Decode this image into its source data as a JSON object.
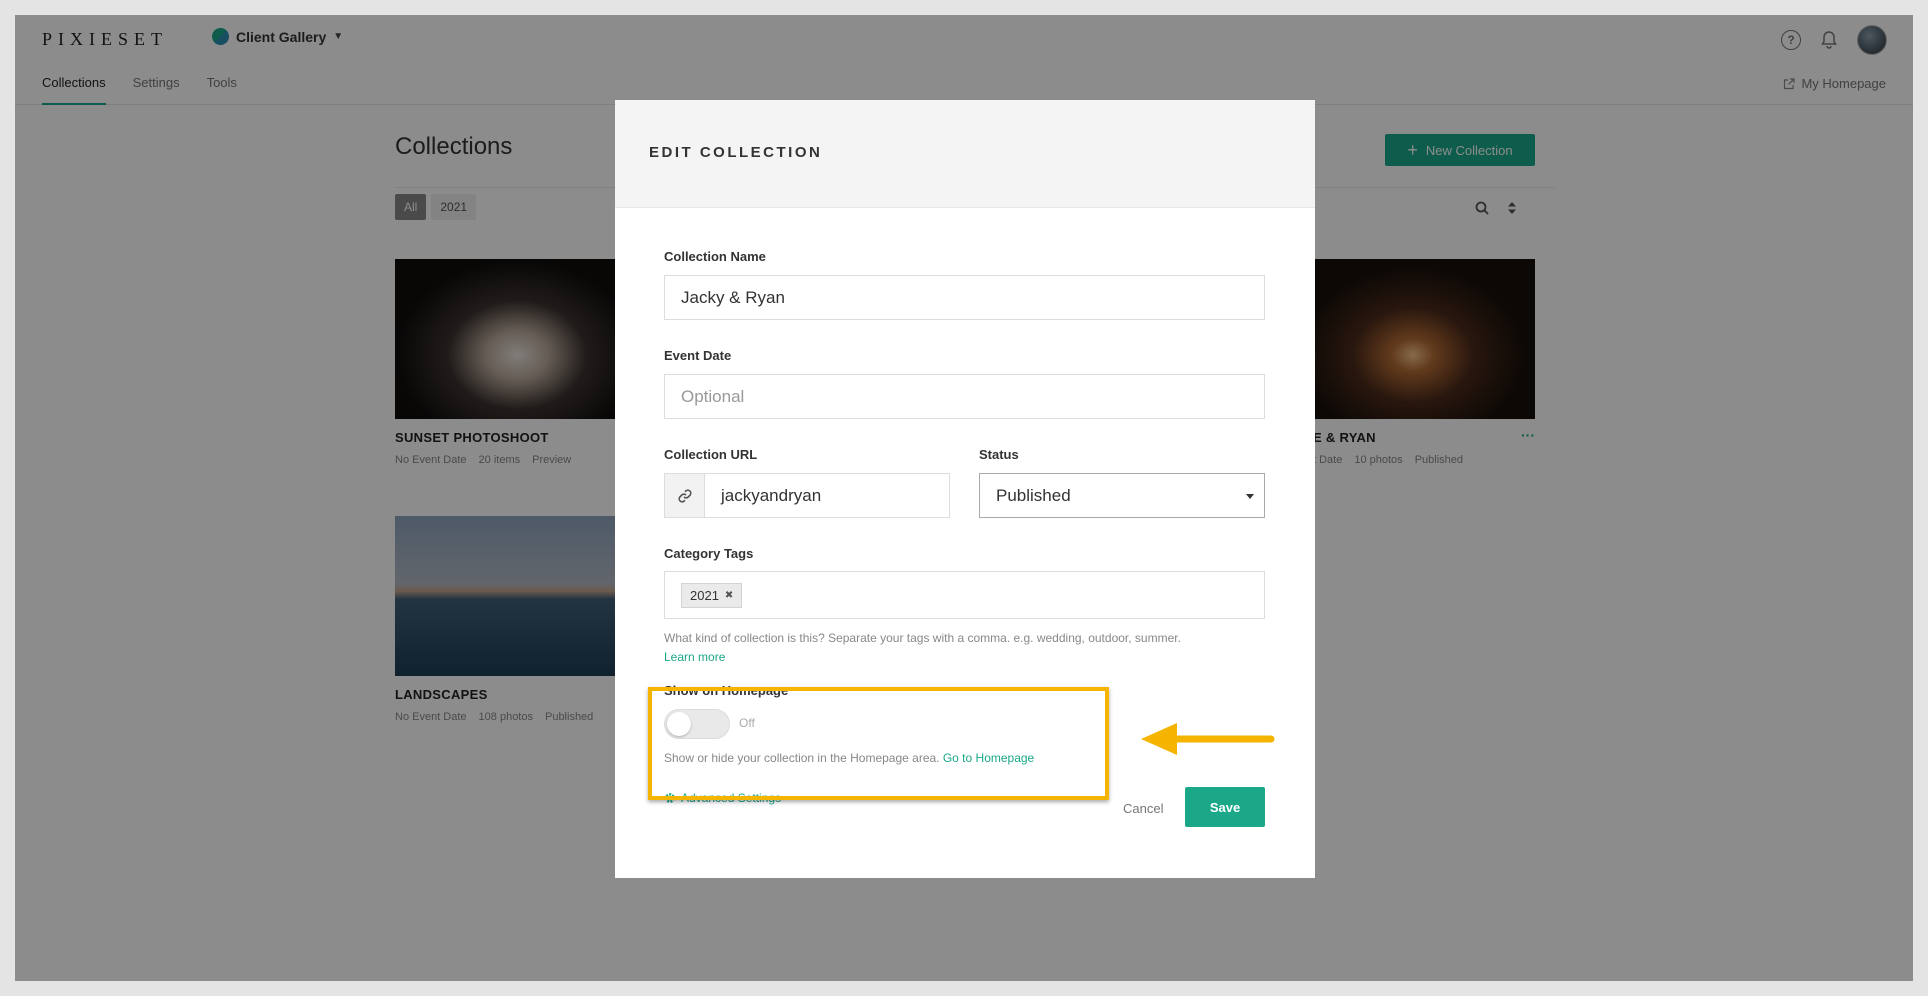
{
  "topbar": {
    "logo": "PIXIESET",
    "gallery_switch": "Client Gallery",
    "icons": [
      "help-icon",
      "bell-icon",
      "avatar"
    ]
  },
  "subnav": {
    "tabs": [
      {
        "label": "Collections",
        "active": true
      },
      {
        "label": "Settings",
        "active": false
      },
      {
        "label": "Tools",
        "active": false
      }
    ],
    "my_homepage": "My Homepage"
  },
  "collections_page": {
    "title": "Collections",
    "new_button": "New Collection",
    "filters": [
      "All",
      "2021"
    ],
    "cards": [
      {
        "title": "SUNSET PHOTOSHOOT",
        "meta": [
          "No Event Date",
          "20 items",
          "Preview"
        ]
      },
      {
        "title": "E & RYAN",
        "meta": [
          "t Date",
          "10 photos",
          "Published"
        ],
        "more": "···"
      },
      {
        "title": "LANDSCAPES",
        "meta": [
          "No Event Date",
          "108 photos",
          "Published"
        ]
      }
    ]
  },
  "modal": {
    "title": "EDIT COLLECTION",
    "collection_name": {
      "label": "Collection Name",
      "value": "Jacky & Ryan"
    },
    "event_date": {
      "label": "Event Date",
      "placeholder": "Optional"
    },
    "collection_url": {
      "label": "Collection URL",
      "value": "jackyandryan"
    },
    "status": {
      "label": "Status",
      "value": "Published"
    },
    "category_tags": {
      "label": "Category Tags",
      "tags": [
        "2021"
      ],
      "help": "What kind of collection is this? Separate your tags with a comma. e.g. wedding, outdoor, summer.",
      "learn_more": "Learn more"
    },
    "show_on_homepage": {
      "label": "Show on Homepage",
      "enabled": false,
      "state_label": "Off",
      "help": "Show or hide your collection in the Homepage area.",
      "link": "Go to Homepage"
    },
    "advanced_settings": "Advanced Settings",
    "cancel": "Cancel",
    "save": "Save"
  },
  "colors": {
    "accent": "#1aa889",
    "highlight": "#f5b400",
    "overlay": "rgba(0,0,0,0.45)"
  }
}
